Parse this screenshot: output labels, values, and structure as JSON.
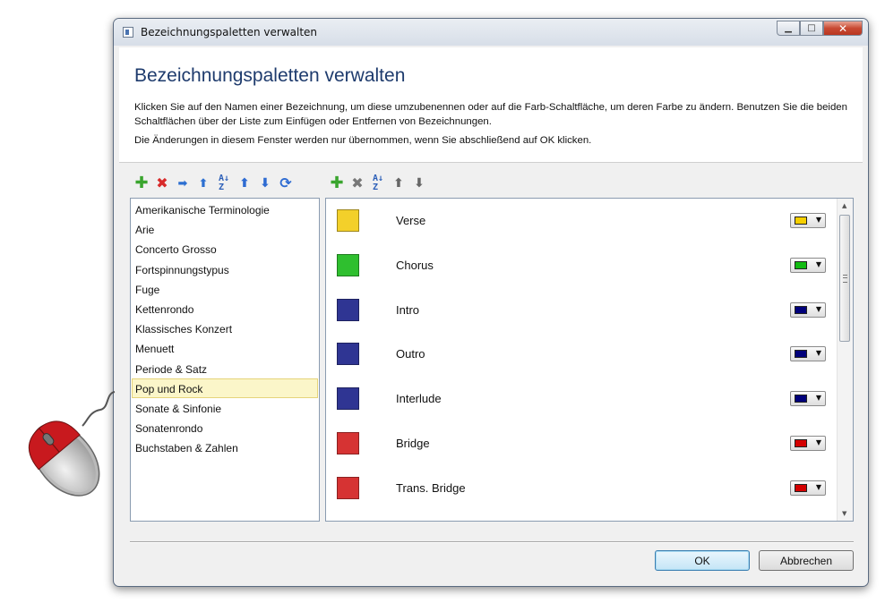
{
  "window": {
    "title": "Bezeichnungspaletten verwalten",
    "controls": {
      "minimize": "▭",
      "maximize": "□",
      "close": "✕"
    }
  },
  "header": {
    "title": "Bezeichnungspaletten verwalten",
    "description": "Klicken Sie auf den Namen einer Bezeichnung, um diese umzubenennen oder auf die Farb-Schaltfläche, um deren Farbe zu ändern. Benutzen Sie die beiden Schaltflächen über der Liste zum Einfügen oder Entfernen von Bezeichnungen.",
    "note": "Die Änderungen in diesem Fenster werden nur übernommen, wenn Sie abschließend auf OK klicken."
  },
  "palette_toolbar": [
    {
      "icon": "add-icon",
      "glyph": "✚"
    },
    {
      "icon": "delete-icon",
      "glyph": "✖"
    },
    {
      "icon": "import-icon",
      "glyph": "➡"
    },
    {
      "icon": "export-icon",
      "glyph": "⬆"
    },
    {
      "icon": "sort-az-icon",
      "glyph": "A↓Z"
    },
    {
      "icon": "move-up-icon",
      "glyph": "🡅"
    },
    {
      "icon": "move-down-icon",
      "glyph": "🡇"
    },
    {
      "icon": "refresh-icon",
      "glyph": "⟳"
    }
  ],
  "label_toolbar": [
    {
      "icon": "add-icon",
      "glyph": "✚"
    },
    {
      "icon": "delete-icon",
      "glyph": "✖"
    },
    {
      "icon": "sort-az-icon",
      "glyph": "A↓Z"
    },
    {
      "icon": "move-up-icon",
      "glyph": "🡅"
    },
    {
      "icon": "move-down-icon",
      "glyph": "🡇"
    }
  ],
  "palettes": {
    "selected": "Pop und Rock",
    "items": [
      "Amerikanische Terminologie",
      "Arie",
      "Concerto Grosso",
      "Fortspinnungstypus",
      "Fuge",
      "Kettenrondo",
      "Klassisches Konzert",
      "Menuett",
      "Periode & Satz",
      "Pop und Rock",
      "Sonate & Sinfonie",
      "Sonatenrondo",
      "Buchstaben & Zahlen"
    ]
  },
  "labels": [
    {
      "name": "Verse",
      "color": "#f3d02a",
      "button_color": "#f5cf00"
    },
    {
      "name": "Chorus",
      "color": "#2fbf2f",
      "button_color": "#12bb12"
    },
    {
      "name": "Intro",
      "color": "#2f3593",
      "button_color": "#00007a"
    },
    {
      "name": "Outro",
      "color": "#2f3593",
      "button_color": "#00007a"
    },
    {
      "name": "Interlude",
      "color": "#2f3593",
      "button_color": "#00007a"
    },
    {
      "name": "Bridge",
      "color": "#d63333",
      "button_color": "#d40000"
    },
    {
      "name": "Trans. Bridge",
      "color": "#d63333",
      "button_color": "#d40000"
    }
  ],
  "buttons": {
    "ok": "OK",
    "cancel": "Abbrechen"
  },
  "scroll": {
    "position": 0
  }
}
